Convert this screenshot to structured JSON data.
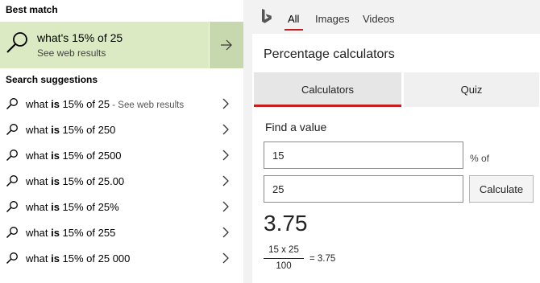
{
  "left_pane": {
    "best_match_label": "Best match",
    "best_match": {
      "title": "what's 15% of 25",
      "subtitle": "See web results"
    },
    "suggestions_label": "Search suggestions",
    "suggestions": [
      {
        "pre": "what ",
        "bold": "is",
        "post": " 15% of 25",
        "extra": " - See web results"
      },
      {
        "pre": "what ",
        "bold": "is",
        "post": " 15% of 250",
        "extra": ""
      },
      {
        "pre": "what ",
        "bold": "is",
        "post": " 15% of 2500",
        "extra": ""
      },
      {
        "pre": "what ",
        "bold": "is",
        "post": " 15% of 25.00",
        "extra": ""
      },
      {
        "pre": "what ",
        "bold": "is",
        "post": " 15% of 25%",
        "extra": ""
      },
      {
        "pre": "what ",
        "bold": "is",
        "post": " 15% of 255",
        "extra": ""
      },
      {
        "pre": "what ",
        "bold": "is",
        "post": " 15% of 25 000",
        "extra": ""
      }
    ]
  },
  "right_pane": {
    "tabs": {
      "all": "All",
      "images": "Images",
      "videos": "Videos"
    },
    "card": {
      "title": "Percentage calculators",
      "tabs": {
        "calculators": "Calculators",
        "quiz": "Quiz"
      },
      "find_label": "Find a value",
      "percent_value": "15",
      "percent_of_label": "% of",
      "base_value": "25",
      "calculate_label": "Calculate",
      "result": "3.75",
      "fraction": {
        "numerator": "15 x 25",
        "denominator": "100",
        "equals": "= 3.75"
      }
    }
  },
  "colors": {
    "best_match_bg": "#dbeac2",
    "best_match_arrow_bg": "#c7d8ae",
    "accent_red": "#c41e1e",
    "right_pane_bg": "#f2f2f2"
  },
  "icons": {
    "best_match": "search-icon",
    "suggestion": "search-icon",
    "arrow": "arrow-right-icon",
    "chevron": "chevron-right-icon",
    "brand": "bing-logo-icon"
  }
}
